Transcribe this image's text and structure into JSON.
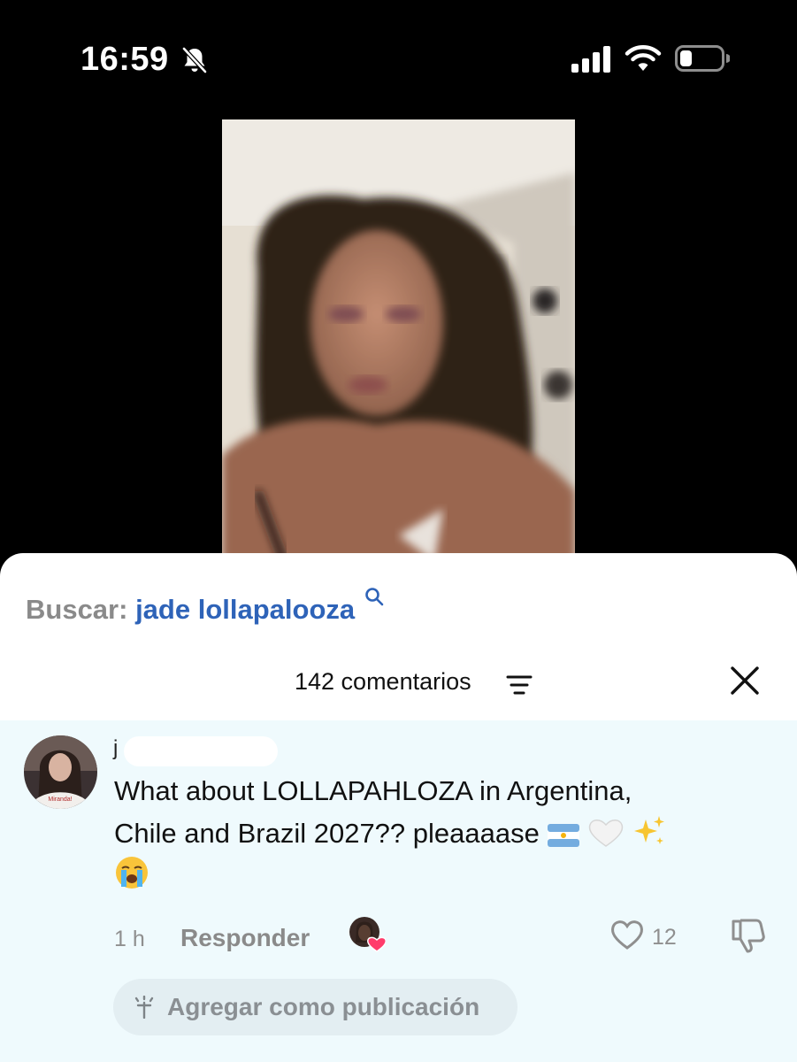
{
  "status_bar": {
    "time": "16:59",
    "icons": [
      "bell-muted-icon",
      "cellular-signal-icon",
      "wifi-icon",
      "battery-low-icon"
    ]
  },
  "search": {
    "label": "Buscar:",
    "query": "jade lollapalooza"
  },
  "comments_header": {
    "count_label": "142 comentarios"
  },
  "comment": {
    "username": "j",
    "avatar_shirt_text": "Miranda!",
    "text_line1": "What about LOLLAPAHLOZA in Argentina,",
    "text_line2": "Chile and Brazil 2027?? pleaaaase",
    "emojis": [
      "argentina-flag",
      "white-heart",
      "sparkles",
      "loudly-crying-face"
    ],
    "time_ago": "1 h",
    "reply_label": "Responder",
    "like_count": "12",
    "add_post_label": "Agregar como publicación"
  },
  "colors": {
    "background": "#000000",
    "sheet": "#ffffff",
    "comment_highlight": "#effafd",
    "search_query": "#2e63b8",
    "muted_text": "#8a8a8a",
    "pill_bg": "#e3eef2",
    "heart_pink": "#ff3b6b"
  }
}
